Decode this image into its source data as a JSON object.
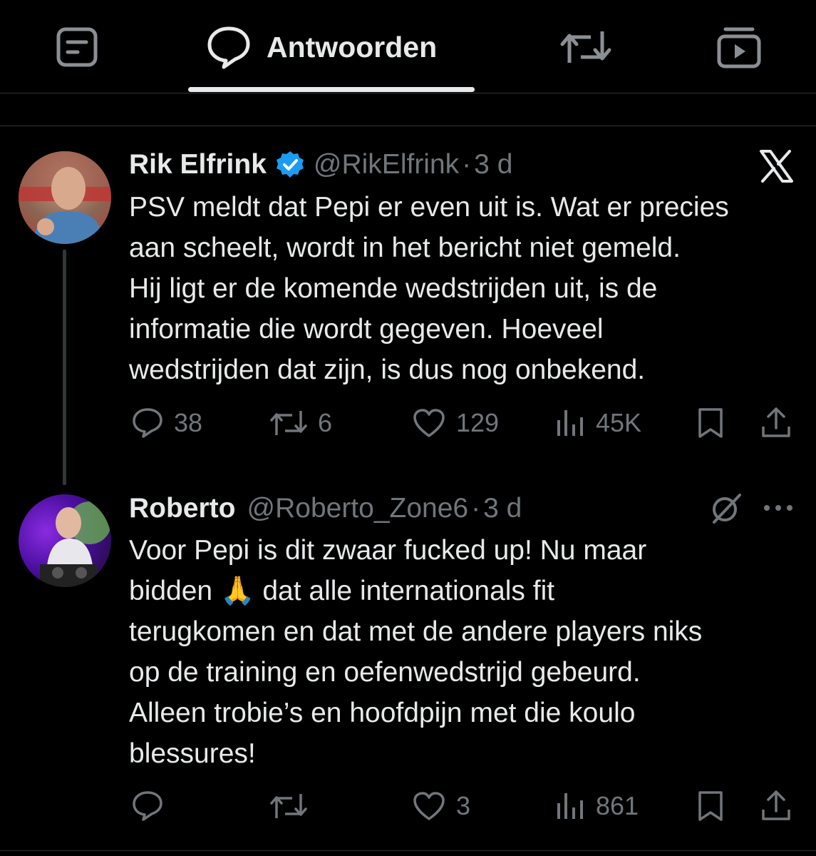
{
  "tabs": [
    {
      "icon": "article-icon",
      "label": ""
    },
    {
      "icon": "reply-bubble-icon",
      "label": "Antwoorden"
    },
    {
      "icon": "retweet-icon",
      "label": ""
    },
    {
      "icon": "video-icon",
      "label": ""
    }
  ],
  "tweet1": {
    "name": "Rik Elfrink",
    "verified": true,
    "handle": "@RikElfrink",
    "dot": "·",
    "time": "3 d",
    "source_icon": "x-logo-icon",
    "lines": [
      "PSV meldt dat Pepi er even uit is. Wat er precies",
      "aan scheelt, wordt in het bericht niet gemeld.",
      "Hij ligt er de komende wedstrijden uit, is de",
      "informatie die wordt gegeven. Hoeveel",
      "wedstrijden dat zijn, is dus nog onbekend."
    ],
    "replies": "38",
    "reposts": "6",
    "likes": "129",
    "views": "45K"
  },
  "tweet2": {
    "name": "Roberto",
    "handle": "@Roberto_Zone6",
    "dot": "·",
    "time": "3 d",
    "lines": [
      "Voor Pepi is dit zwaar fucked up! Nu maar",
      "bidden 🙏 dat alle internationals fit",
      "terugkomen en dat met de andere players niks",
      "op de training en oefenwedstrijd gebeurd.",
      "Alleen trobie’s en hoofdpijn met die koulo",
      "blessures!"
    ],
    "replies": "",
    "reposts": "",
    "likes": "3",
    "views": "861"
  },
  "colors": {
    "text": "#e7e9ea",
    "muted": "#71767b",
    "verified": "#1d9bf0",
    "divider": "#2f3336"
  }
}
